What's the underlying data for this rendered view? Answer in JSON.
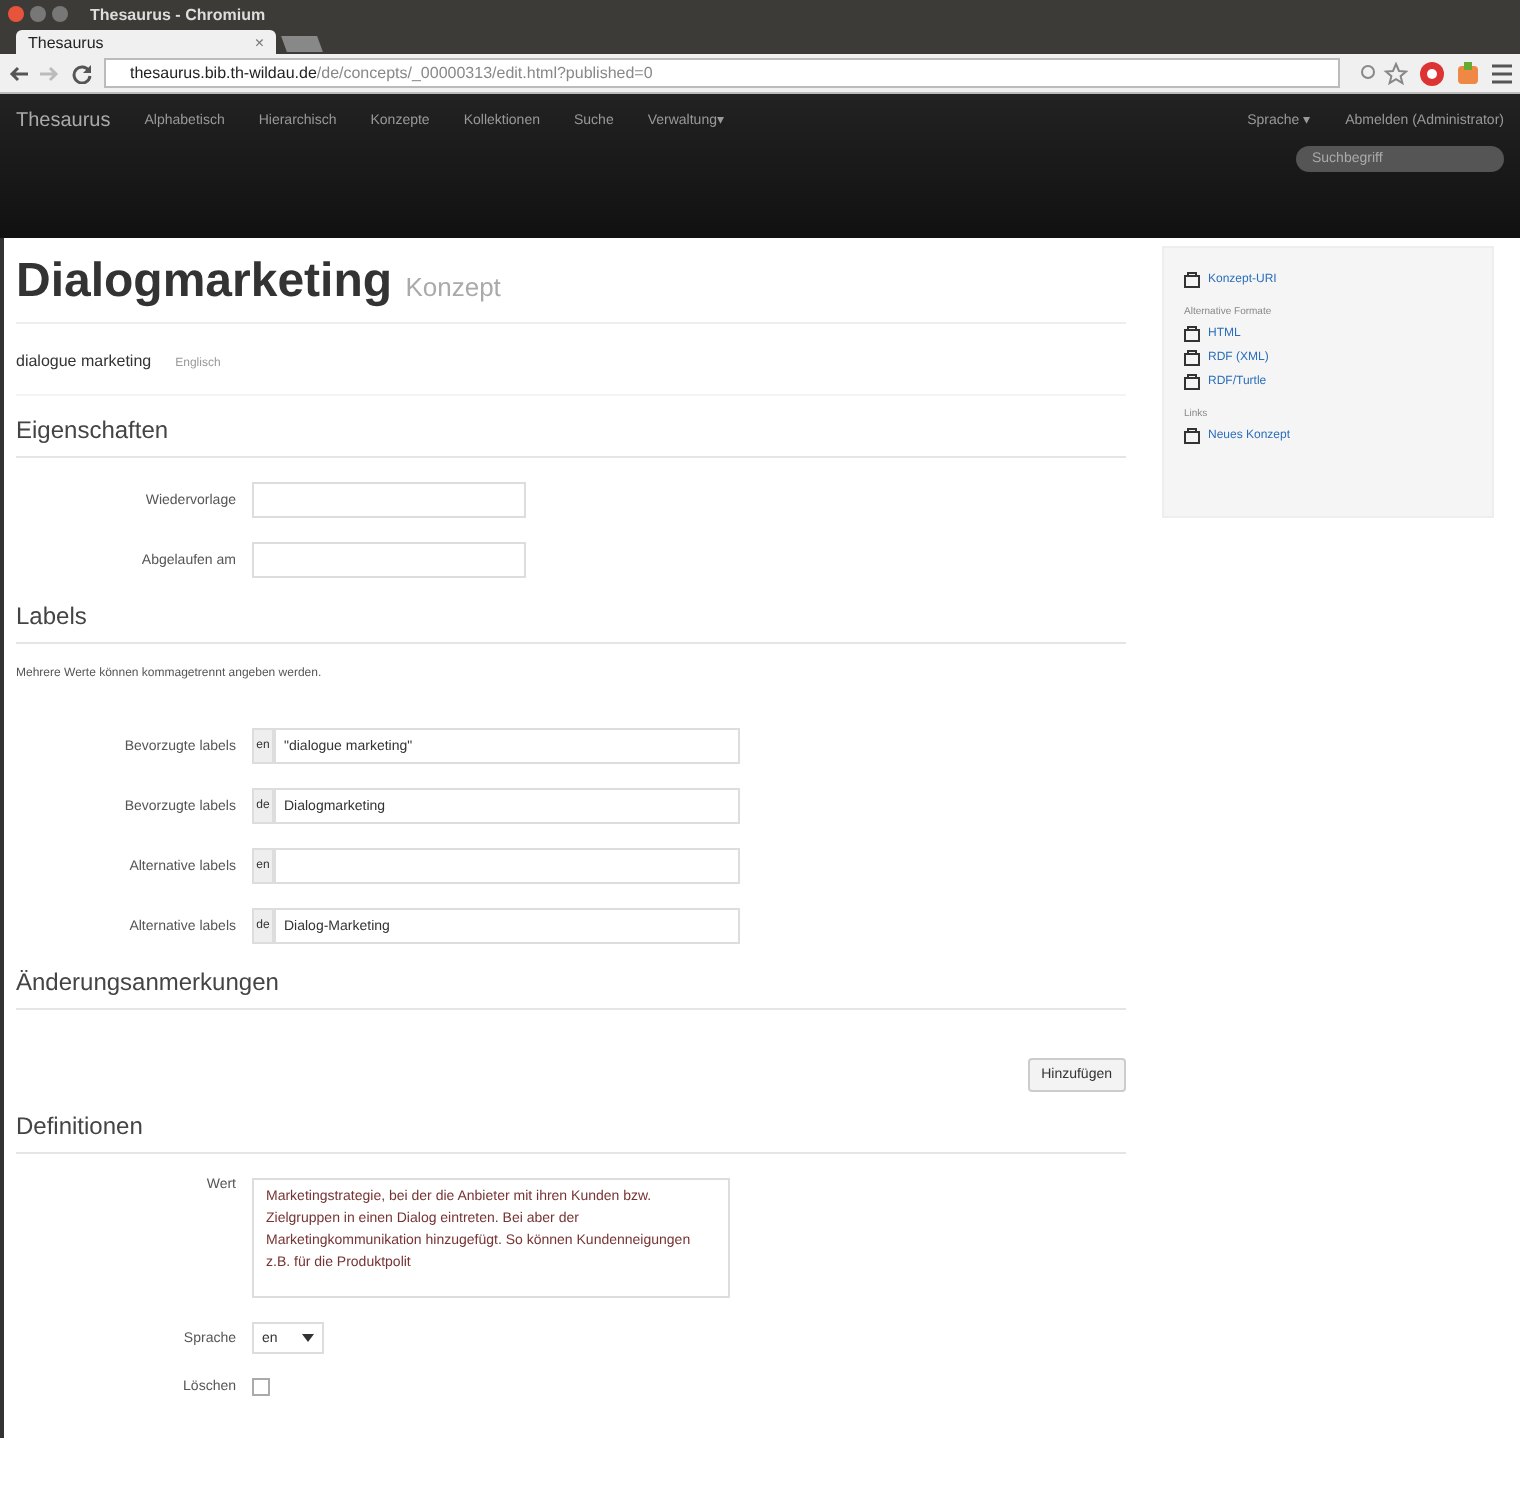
{
  "window": {
    "title": "Thesaurus - Chromium"
  },
  "tabs": [
    {
      "label": "Thesaurus",
      "close": "×"
    }
  ],
  "address_bar": {
    "host": "thesaurus.bib.th-wildau.de",
    "path": "/de/concepts/_00000313/edit.html?published=0"
  },
  "navbar": {
    "brand": "Thesaurus",
    "items": [
      "Alphabetisch",
      "Hierarchisch",
      "Konzepte",
      "Kollektionen",
      "Suche",
      "Verwaltung▾"
    ],
    "right_items": [
      "Sprache ▾",
      "Abmelden (Administrator)"
    ],
    "search": {
      "placeholder": "Suchbegriff"
    }
  },
  "heading": {
    "title": "Dialogmarketing",
    "subtitle": "Konzept"
  },
  "pref_label": {
    "text": "dialogue marketing",
    "language": "Englisch"
  },
  "sections": [
    {
      "kind": "properties",
      "title": "Eigenschaften",
      "fields": [
        {
          "label": "Wiedervorlage"
        },
        {
          "label": "Abgelaufen am"
        }
      ]
    },
    {
      "kind": "labels",
      "title": "Labels",
      "hint": "Mehrere Werte können kommagetrennt angeben werden.",
      "fields": [
        {
          "label": "Bevorzugte labels",
          "lang": "en",
          "value": "\"dialogue marketing\""
        },
        {
          "label": "Bevorzugte labels",
          "lang": "de",
          "value": "Dialogmarketing"
        },
        {
          "label": "Alternative labels",
          "lang": "en"
        },
        {
          "label": "Alternative labels",
          "lang": "de",
          "value": "Dialog-Marketing"
        }
      ]
    },
    {
      "kind": "notes",
      "title": "Änderungsanmerkungen",
      "button": "Hinzufügen"
    },
    {
      "kind": "definitions",
      "title": "Definitionen",
      "value_label": "Wert",
      "value": "Marketingstrategie, bei der die Anbieter mit ihren Kunden bzw. Zielgruppen in einen Dialog eintreten. Bei aber der Marketingkommunikation hinzugefügt. So können Kundenneigungen z.B. für die Produktpolit",
      "language_label": "Sprache",
      "language": "en",
      "delete_label": "Löschen",
      "delete_checked": false
    }
  ],
  "sidebar": {
    "groups": [
      {
        "items": [
          "Konzept-URI"
        ]
      },
      {
        "heading": "Alternative Formate",
        "items": [
          "HTML",
          "RDF (XML)",
          "RDF/Turtle"
        ]
      },
      {
        "heading": "Links",
        "items": [
          "Neues Konzept"
        ]
      }
    ]
  }
}
